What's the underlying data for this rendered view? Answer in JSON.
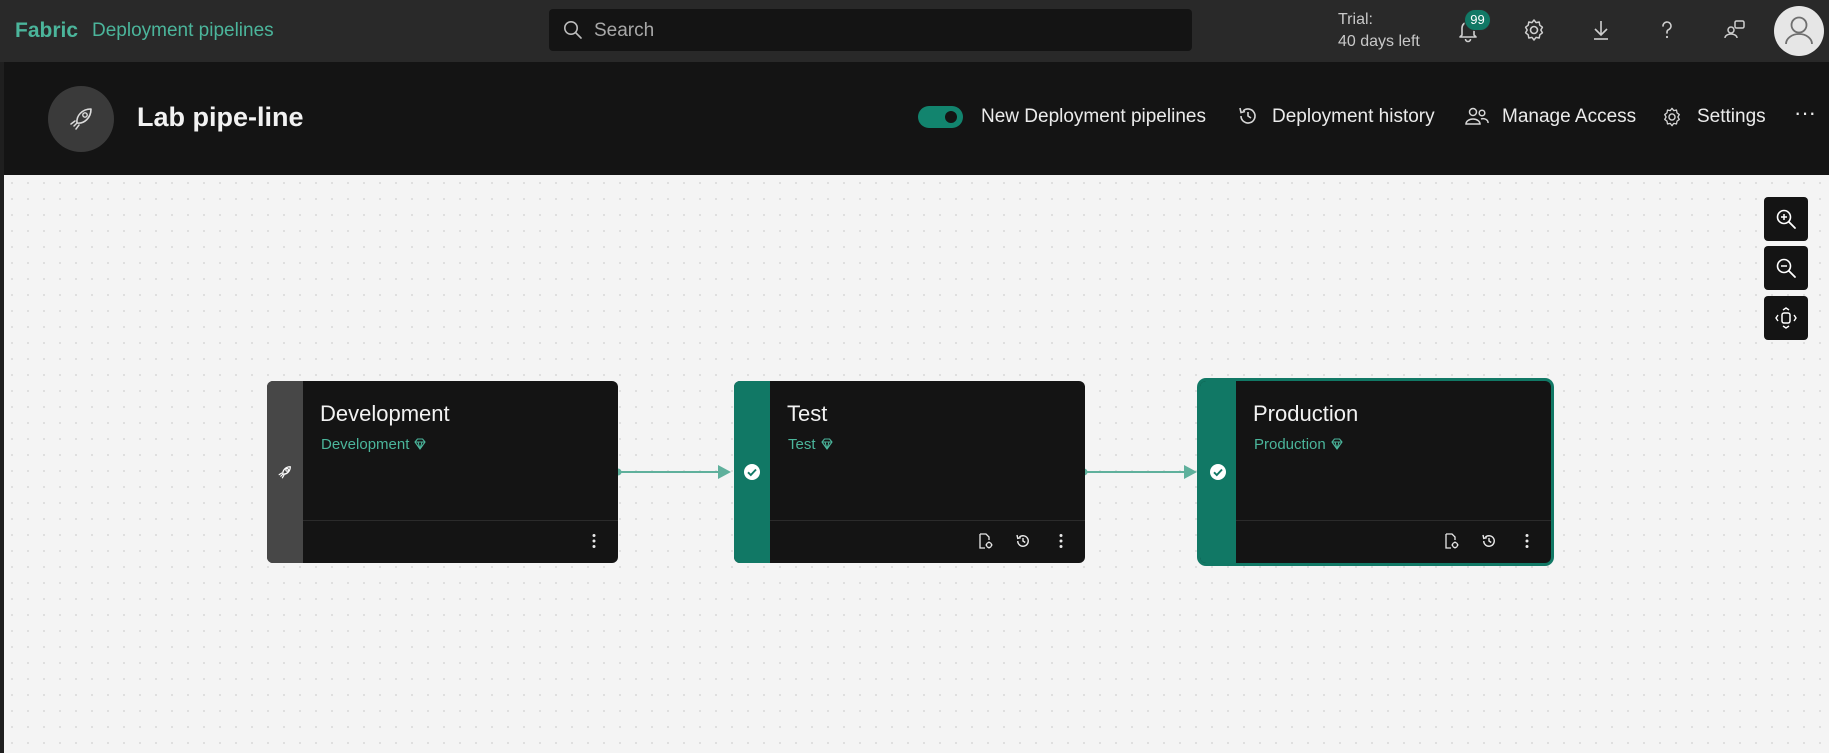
{
  "topbar": {
    "brand": "Fabric",
    "product": "Deployment pipelines",
    "search_placeholder": "Search",
    "trial_line1": "Trial:",
    "trial_line2": "40 days left",
    "notification_count": "99",
    "icons": [
      "bell-icon",
      "gear-icon",
      "download-icon",
      "help-icon",
      "share-icon",
      "avatar"
    ]
  },
  "header": {
    "title": "Lab pipe-line",
    "toggle_label": "New Deployment pipelines",
    "toggle_on": true,
    "deployment_history": "Deployment history",
    "manage_access": "Manage Access",
    "settings": "Settings",
    "more": "···"
  },
  "stages": [
    {
      "name": "Development",
      "workspace": "Development",
      "status": "none"
    },
    {
      "name": "Test",
      "workspace": "Test",
      "status": "deployed"
    },
    {
      "name": "Production",
      "workspace": "Production",
      "status": "deployed",
      "selected": true
    }
  ],
  "colors": {
    "accent": "#4bb59b",
    "stage_active": "#117865",
    "stage_inactive": "#474747",
    "connector": "#5fb09c"
  }
}
